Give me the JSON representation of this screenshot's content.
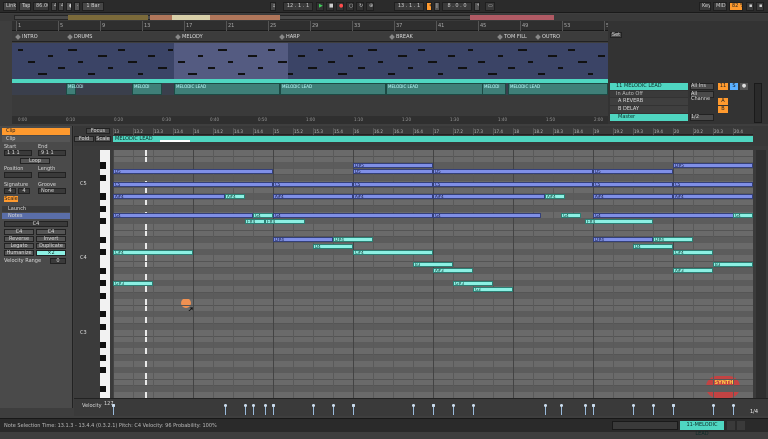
{
  "transport": {
    "link_label": "Link",
    "tap_label": "Tap",
    "tempo": "86.00",
    "time_sig_num": "4",
    "time_sig_den": "4",
    "quantize": "1 Bar",
    "position": "12 . 1 . 1",
    "loop_start": "13 . 1 . 1",
    "loop_length": "8 . 0 . 0",
    "key_label": "Key",
    "midi_label": "MIDI",
    "cpu": "82 %"
  },
  "locators": [
    "INTRO",
    "DRUMS",
    "MELODY",
    "HARP",
    "BREAK",
    "TOM FILL",
    "OUTRO"
  ],
  "ruler_ticks": [
    "1",
    "5",
    "9",
    "13",
    "17",
    "21",
    "25",
    "29",
    "33",
    "37",
    "41",
    "45",
    "49",
    "53",
    "57"
  ],
  "arrange_time_ticks": [
    "0:00",
    "0:10",
    "0:20",
    "0:30",
    "0:40",
    "0:50",
    "1:00",
    "1:10",
    "1:20",
    "1:30",
    "1:40",
    "1:50",
    "2:00"
  ],
  "clips": [
    {
      "label": "MELODI"
    },
    {
      "label": "MELODI"
    },
    {
      "label": "MELODIC LEAD"
    },
    {
      "label": "MELODIC LEAD"
    },
    {
      "label": "MELODIC LEAD"
    },
    {
      "label": "MELODI"
    },
    {
      "label": "MELODIC LEAD"
    }
  ],
  "mixer": {
    "set_label": "Set",
    "tracks": [
      {
        "name": "11 MELODIC LEAD",
        "input": "All Ins",
        "channel": "All Channe",
        "monitor": "In Auto Off",
        "number": "11"
      },
      {
        "name": "A REVERB",
        "letter": "A"
      },
      {
        "name": "B DELAY",
        "letter": "B"
      },
      {
        "name": "Master",
        "out": "1/2"
      }
    ],
    "midi_from": "MIDI From",
    "ext_label": "Ext. In"
  },
  "clip_panel": {
    "title": "Clip",
    "name": "Clip",
    "start_label": "Start",
    "end_label": "End",
    "start_value": "1 1 1",
    "end_value": "9 1 1",
    "loop_label": "Loop",
    "position_label": "Position",
    "length_label": "Length",
    "signature_label": "Signature",
    "groove_label": "Groove",
    "sig_num": "4",
    "sig_den": "4",
    "groove_value": "None",
    "scale_label": "Scale",
    "launch_label": "Launch",
    "notes_label": "Notes",
    "note_name": "C4",
    "pitch_value": "C4",
    "mult2": "×2",
    "div2": ":2",
    "reverse_label": "Reverse",
    "invert_label": "Invert",
    "legato_label": "Legato",
    "duplicate_label": "Duplicate",
    "humanize_label": "Humanize",
    "velocity_range_label": "Velocity Range",
    "velocity_value": "0"
  },
  "editor": {
    "fold_label": "Fold",
    "scale_label": "Scale",
    "focus_label": "Focus",
    "clip_name": "MELODIC LEAD",
    "bar_ticks": [
      "13",
      "13.2",
      "13.3",
      "13.4",
      "14",
      "14.2",
      "14.3",
      "14.4",
      "15",
      "15.2",
      "15.3",
      "15.4",
      "16",
      "16.2",
      "16.3",
      "16.4",
      "17",
      "17.2",
      "17.3",
      "17.4",
      "18",
      "18.2",
      "18.3",
      "18.4",
      "19",
      "19.2",
      "19.3",
      "19.4",
      "20",
      "20.2",
      "20.3",
      "20.4"
    ],
    "octave_labels": [
      "C5",
      "C4",
      "C3"
    ],
    "velocity_label": "Velocity",
    "velocity_max": "127",
    "page_indicator": "1/4",
    "watermark_text": "SYNTH WAVE PRO",
    "notes": [
      {
        "pitch": "D#5",
        "start": 3.0,
        "len": 1.0,
        "color": "blue"
      },
      {
        "pitch": "D#5",
        "start": 7.0,
        "len": 1.0,
        "color": "blue"
      },
      {
        "pitch": "D5",
        "start": 0.0,
        "len": 2.0,
        "color": "blue"
      },
      {
        "pitch": "D5",
        "start": 3.0,
        "len": 1.0,
        "color": "blue"
      },
      {
        "pitch": "D5",
        "start": 4.0,
        "len": 2.0,
        "color": "blue"
      },
      {
        "pitch": "D5",
        "start": 6.0,
        "len": 1.0,
        "color": "blue"
      },
      {
        "pitch": "C5",
        "start": 0.0,
        "len": 2.0,
        "color": "blue"
      },
      {
        "pitch": "C5",
        "start": 2.0,
        "len": 1.0,
        "color": "blue"
      },
      {
        "pitch": "C5",
        "start": 3.0,
        "len": 1.0,
        "color": "blue"
      },
      {
        "pitch": "C5",
        "start": 4.0,
        "len": 2.0,
        "color": "blue"
      },
      {
        "pitch": "C5",
        "start": 6.0,
        "len": 1.0,
        "color": "blue"
      },
      {
        "pitch": "C5",
        "start": 7.0,
        "len": 1.0,
        "color": "blue"
      },
      {
        "pitch": "A#4",
        "start": 0.0,
        "len": 1.4,
        "color": "blue"
      },
      {
        "pitch": "A#4",
        "start": 1.4,
        "len": 0.25,
        "color": "teal"
      },
      {
        "pitch": "A#4",
        "start": 2.0,
        "len": 1.0,
        "color": "blue"
      },
      {
        "pitch": "A#4",
        "start": 3.0,
        "len": 1.0,
        "color": "blue"
      },
      {
        "pitch": "A#4",
        "start": 4.0,
        "len": 1.4,
        "color": "blue"
      },
      {
        "pitch": "A#4",
        "start": 5.4,
        "len": 0.25,
        "color": "teal"
      },
      {
        "pitch": "A#4",
        "start": 6.0,
        "len": 1.0,
        "color": "blue"
      },
      {
        "pitch": "A#4",
        "start": 7.0,
        "len": 1.0,
        "color": "blue"
      },
      {
        "pitch": "G4",
        "start": 0.0,
        "len": 1.75,
        "color": "blue"
      },
      {
        "pitch": "G4",
        "start": 1.75,
        "len": 0.25,
        "color": "teal"
      },
      {
        "pitch": "G4",
        "start": 2.0,
        "len": 2.0,
        "color": "blue"
      },
      {
        "pitch": "G4",
        "start": 4.0,
        "len": 1.35,
        "color": "blue"
      },
      {
        "pitch": "G4",
        "start": 5.6,
        "len": 0.25,
        "color": "teal"
      },
      {
        "pitch": "G4",
        "start": 6.0,
        "len": 2.0,
        "color": "blue"
      },
      {
        "pitch": "G4",
        "start": 7.75,
        "len": 0.25,
        "color": "teal"
      },
      {
        "pitch": "F#4",
        "start": 1.65,
        "len": 0.25,
        "color": "teal"
      },
      {
        "pitch": "F#4",
        "start": 1.9,
        "len": 0.5,
        "color": "teal"
      },
      {
        "pitch": "F#4",
        "start": 5.9,
        "len": 0.85,
        "color": "teal"
      },
      {
        "pitch": "D#4",
        "start": 2.0,
        "len": 0.75,
        "color": "blue"
      },
      {
        "pitch": "D#4",
        "start": 2.75,
        "len": 0.5,
        "color": "teal"
      },
      {
        "pitch": "D#4",
        "start": 6.0,
        "len": 0.75,
        "color": "blue"
      },
      {
        "pitch": "D#4",
        "start": 6.75,
        "len": 0.5,
        "color": "teal"
      },
      {
        "pitch": "D4",
        "start": 2.5,
        "len": 0.5,
        "color": "teal"
      },
      {
        "pitch": "D4",
        "start": 6.5,
        "len": 0.5,
        "color": "teal"
      },
      {
        "pitch": "C#4",
        "start": 0.0,
        "len": 1.0,
        "color": "teal"
      },
      {
        "pitch": "C#4",
        "start": 3.0,
        "len": 1.0,
        "color": "teal"
      },
      {
        "pitch": "C#4",
        "start": 7.0,
        "len": 0.5,
        "color": "teal"
      },
      {
        "pitch": "B3",
        "start": 3.75,
        "len": 0.5,
        "color": "teal"
      },
      {
        "pitch": "B3",
        "start": 7.5,
        "len": 0.5,
        "color": "teal"
      },
      {
        "pitch": "A#3",
        "start": 4.0,
        "len": 0.5,
        "color": "teal"
      },
      {
        "pitch": "A#3",
        "start": 7.0,
        "len": 0.5,
        "color": "teal"
      },
      {
        "pitch": "G#3",
        "start": 0.0,
        "len": 0.5,
        "color": "teal"
      },
      {
        "pitch": "G#3",
        "start": 4.25,
        "len": 0.5,
        "color": "teal"
      },
      {
        "pitch": "G3",
        "start": -0.25,
        "len": 0.25,
        "color": "teal"
      },
      {
        "pitch": "G3",
        "start": 4.5,
        "len": 0.5,
        "color": "teal"
      }
    ]
  },
  "status_bar": {
    "text": "Note Selection  Time: 13.1.3 - 13.4.4 (0.3.2.1)  Pitch: C4  Velocity: 96  Probability: 100%",
    "track_label": "11-MELODIC LEAD"
  },
  "colors": {
    "blue_note": "#7f8fe6",
    "teal_note": "#8cf0e3",
    "clip_green": "#4fd6c1",
    "accent_orange": "#ff9a2e",
    "play_green": "#3fcf5a"
  }
}
